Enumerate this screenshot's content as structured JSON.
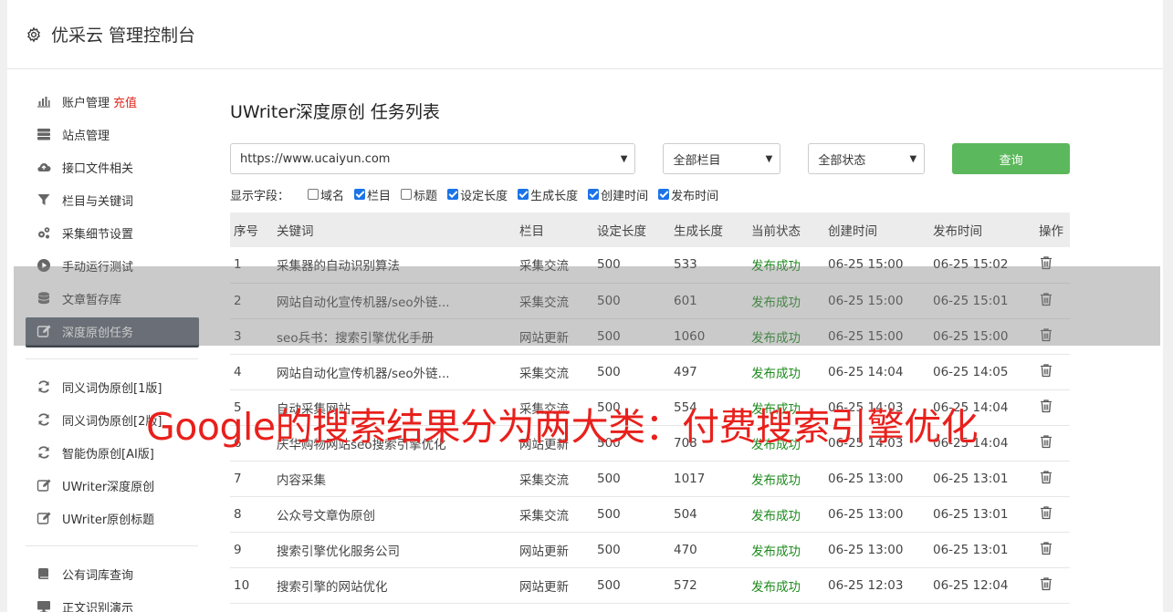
{
  "header": {
    "title": "优采云 管理控制台",
    "icon": "gear-icon"
  },
  "sidebar": {
    "groups": [
      [
        {
          "label": "账户管理",
          "badge": "充值",
          "icon": "bar-chart-icon"
        },
        {
          "label": "站点管理",
          "icon": "server-icon"
        },
        {
          "label": "接口文件相关",
          "icon": "cloud-upload-icon"
        },
        {
          "label": "栏目与关键词",
          "icon": "filter-icon"
        },
        {
          "label": "采集细节设置",
          "icon": "gears-icon"
        },
        {
          "label": "手动运行测试",
          "icon": "play-circle-icon"
        },
        {
          "label": "文章暂存库",
          "icon": "database-icon"
        },
        {
          "label": "深度原创任务",
          "icon": "edit-icon",
          "active": true
        }
      ],
      [
        {
          "label": "同义词伪原创[1版]",
          "icon": "refresh-icon"
        },
        {
          "label": "同义词伪原创[2版]",
          "icon": "refresh-icon"
        },
        {
          "label": "智能伪原创[AI版]",
          "icon": "refresh-icon"
        },
        {
          "label": "UWriter深度原创",
          "icon": "edit-icon"
        },
        {
          "label": "UWriter原创标题",
          "icon": "edit-icon"
        }
      ],
      [
        {
          "label": "公有词库查询",
          "icon": "book-icon"
        },
        {
          "label": "正文识别演示",
          "icon": "monitor-icon"
        }
      ]
    ]
  },
  "main": {
    "title": "UWriter深度原创 任务列表",
    "filters": {
      "site": "https://www.ucaiyun.com",
      "column": "全部栏目",
      "status": "全部状态",
      "query_label": "查询"
    },
    "fields_label": "显示字段：",
    "fields": [
      {
        "label": "域名",
        "checked": false
      },
      {
        "label": "栏目",
        "checked": true
      },
      {
        "label": "标题",
        "checked": false
      },
      {
        "label": "设定长度",
        "checked": true
      },
      {
        "label": "生成长度",
        "checked": true
      },
      {
        "label": "创建时间",
        "checked": true
      },
      {
        "label": "发布时间",
        "checked": true
      }
    ],
    "table": {
      "headers": [
        "序号",
        "关键词",
        "栏目",
        "设定长度",
        "生成长度",
        "当前状态",
        "创建时间",
        "发布时间",
        "操作"
      ],
      "rows": [
        [
          "1",
          "采集器的自动识别算法",
          "采集交流",
          "500",
          "533",
          "发布成功",
          "06-25 15:00",
          "06-25 15:02"
        ],
        [
          "2",
          "网站自动化宣传机器/seo外链...",
          "采集交流",
          "500",
          "601",
          "发布成功",
          "06-25 15:00",
          "06-25 15:01"
        ],
        [
          "3",
          "seo兵书：搜索引擎优化手册",
          "网站更新",
          "500",
          "1060",
          "发布成功",
          "06-25 15:00",
          "06-25 15:00"
        ],
        [
          "4",
          "网站自动化宣传机器/seo外链...",
          "采集交流",
          "500",
          "497",
          "发布成功",
          "06-25 14:04",
          "06-25 14:05"
        ],
        [
          "5",
          "自动采集网站",
          "采集交流",
          "500",
          "554",
          "发布成功",
          "06-25 14:03",
          "06-25 14:04"
        ],
        [
          "6",
          "庆华购物网站seo搜索引擎优化",
          "网站更新",
          "500",
          "708",
          "发布成功",
          "06-25 14:03",
          "06-25 14:04"
        ],
        [
          "7",
          "内容采集",
          "采集交流",
          "500",
          "1017",
          "发布成功",
          "06-25 13:00",
          "06-25 13:01"
        ],
        [
          "8",
          "公众号文章伪原创",
          "采集交流",
          "500",
          "504",
          "发布成功",
          "06-25 13:00",
          "06-25 13:01"
        ],
        [
          "9",
          "搜索引擎优化服务公司",
          "网站更新",
          "500",
          "470",
          "发布成功",
          "06-25 13:00",
          "06-25 13:01"
        ],
        [
          "10",
          "搜索引擎的网站优化",
          "网站更新",
          "500",
          "572",
          "发布成功",
          "06-25 12:03",
          "06-25 12:04"
        ]
      ]
    }
  },
  "banner": {
    "text": "Google的搜索结果分为两大类：付费搜索引擎优化",
    "color": "#e8201c"
  },
  "colors": {
    "accent": "#5cb85c",
    "active_nav": "#5a6270",
    "status_ok": "#1d8a1d",
    "badge": "#e0281f"
  }
}
